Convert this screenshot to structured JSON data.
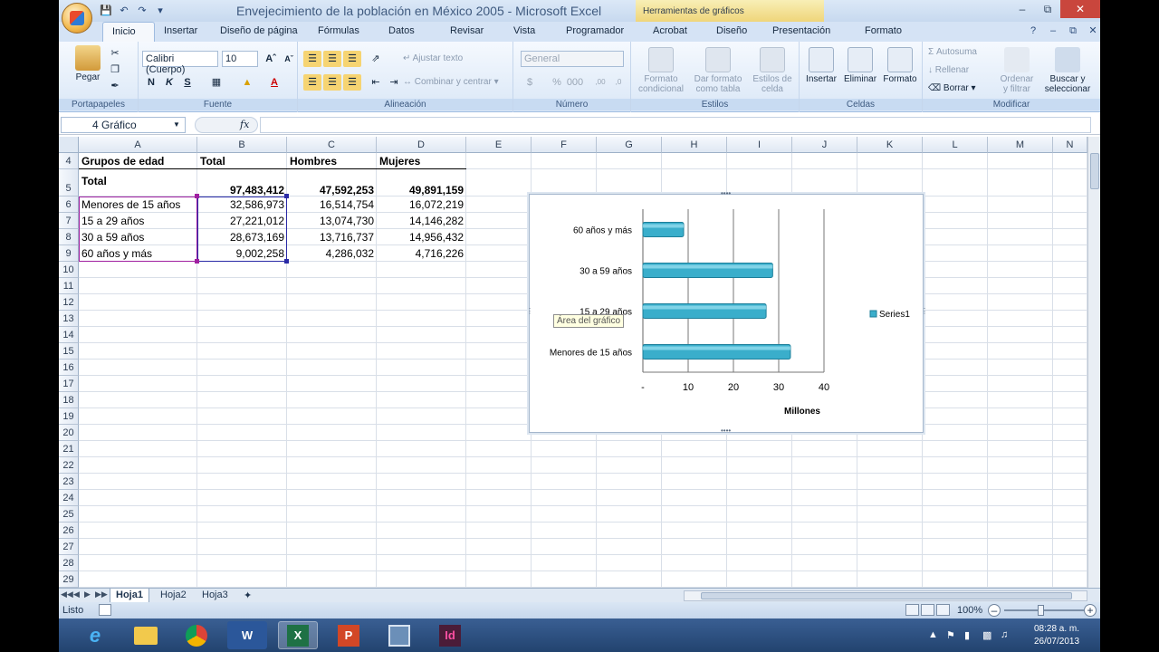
{
  "window": {
    "title": "Envejecimiento de la población en México 2005 - Microsoft Excel",
    "context_tool_title": "Herramientas de gráficos"
  },
  "ribbon_tabs": [
    "Inicio",
    "Insertar",
    "Diseño de página",
    "Fórmulas",
    "Datos",
    "Revisar",
    "Vista",
    "Programador",
    "Acrobat",
    "Diseño",
    "Presentación",
    "Formato"
  ],
  "active_tab": "Inicio",
  "ribbon": {
    "clipboard": {
      "paste": "Pegar",
      "label": "Portapapeles"
    },
    "font": {
      "name": "Calibri (Cuerpo)",
      "size": "10",
      "label": "Fuente"
    },
    "alignment": {
      "wrap": "Ajustar texto",
      "merge": "Combinar y centrar",
      "label": "Alineación"
    },
    "number": {
      "format": "General",
      "label": "Número"
    },
    "styles": {
      "conditional_line1": "Formato",
      "conditional_line2": "condicional",
      "table_line1": "Dar formato",
      "table_line2": "como tabla",
      "cell_styles_line1": "Estilos de",
      "cell_styles_line2": "celda",
      "label": "Estilos"
    },
    "cells": {
      "insert": "Insertar",
      "delete": "Eliminar",
      "format": "Formato",
      "label": "Celdas"
    },
    "editing": {
      "autosum": "Autosuma",
      "fill": "Rellenar",
      "clear": "Borrar",
      "sort_line1": "Ordenar",
      "sort_line2": "y filtrar",
      "find_line1": "Buscar y",
      "find_line2": "seleccionar",
      "label": "Modificar"
    }
  },
  "formula_bar": {
    "name_box": "4 Gráfico",
    "fx": "fx",
    "value": ""
  },
  "columns": [
    "A",
    "B",
    "C",
    "D",
    "E",
    "F",
    "G",
    "H",
    "I",
    "J",
    "K",
    "L",
    "M",
    "N"
  ],
  "rows": [
    "4",
    "5",
    "6",
    "7",
    "8",
    "9",
    "10",
    "11",
    "12",
    "13",
    "14",
    "15",
    "16",
    "17",
    "18",
    "19",
    "20",
    "21",
    "22",
    "23",
    "24",
    "25",
    "26",
    "27",
    "28",
    "29"
  ],
  "table": {
    "headers": [
      "Grupos de edad",
      "Total",
      "Hombres",
      "Mujeres"
    ],
    "total_row": {
      "label": "Total",
      "total": "97,483,412",
      "hombres": "47,592,253",
      "mujeres": "49,891,159"
    },
    "data_rows": [
      {
        "label": "Menores de 15 años",
        "total": "32,586,973",
        "hombres": "16,514,754",
        "mujeres": "16,072,219"
      },
      {
        "label": "15 a 29 años",
        "total": "27,221,012",
        "hombres": "13,074,730",
        "mujeres": "14,146,282"
      },
      {
        "label": "30 a 59 años",
        "total": "28,673,169",
        "hombres": "13,716,737",
        "mujeres": "14,956,432"
      },
      {
        "label": "60 años y más",
        "total": "9,002,258",
        "hombres": "4,286,032",
        "mujeres": "4,716,226"
      }
    ]
  },
  "chart_data": {
    "type": "bar",
    "orientation": "horizontal",
    "categories": [
      "Menores de 15 años",
      "15 a 29 años",
      "30 a 59 años",
      "60 años y más"
    ],
    "series": [
      {
        "name": "Series1",
        "values": [
          32.59,
          27.22,
          28.67,
          9.0
        ]
      }
    ],
    "xlabel": "Millones",
    "xticks": [
      "-",
      "10",
      "20",
      "30",
      "40"
    ],
    "xlim": [
      0,
      40
    ],
    "grid": true,
    "legend_position": "right",
    "bar_color": "#3aaecb",
    "tooltip": "Área del gráfico"
  },
  "sheet_tabs": [
    "Hoja1",
    "Hoja2",
    "Hoja3"
  ],
  "active_sheet": "Hoja1",
  "status": {
    "text": "Listo",
    "zoom": "100%"
  },
  "taskbar": {
    "apps": [
      "internet-explorer",
      "file-explorer",
      "chrome",
      "word",
      "excel",
      "powerpoint",
      "video",
      "indesign"
    ],
    "clock_time": "08:28 a. m.",
    "clock_date": "26/07/2013",
    "indesign_label": "Id"
  }
}
